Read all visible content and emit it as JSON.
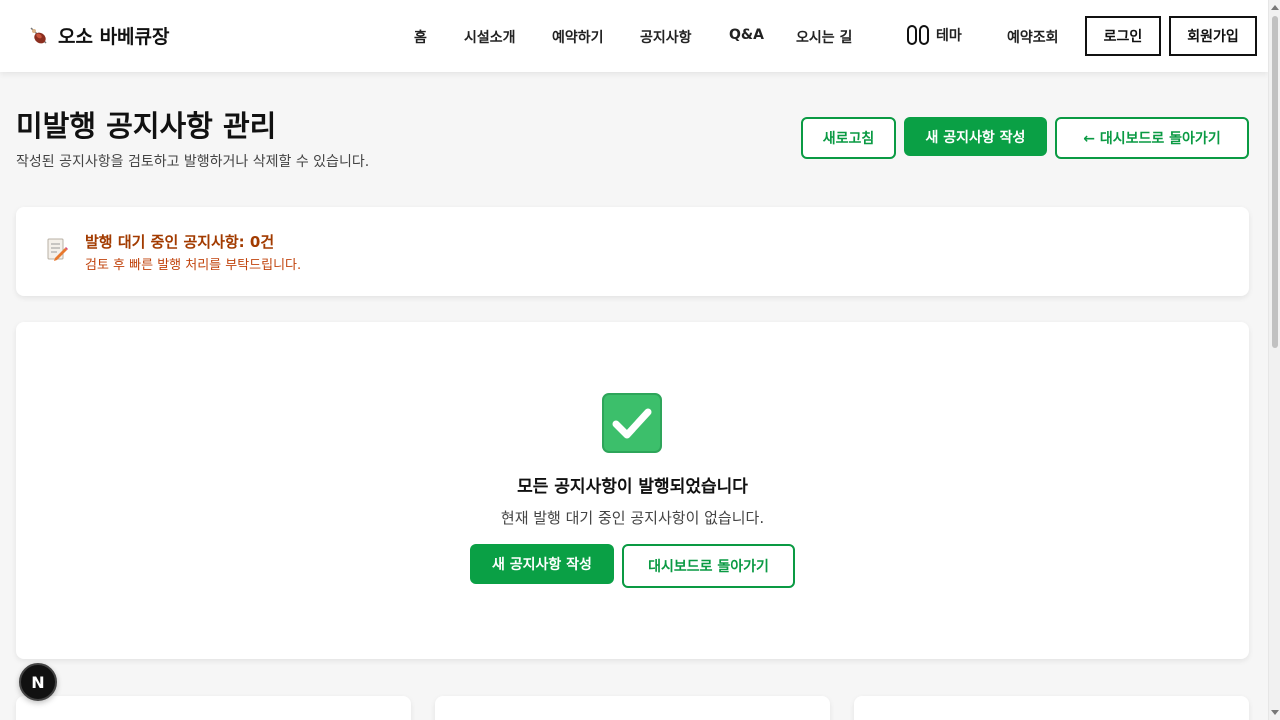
{
  "header": {
    "brand": "오소 바베큐장",
    "nav": [
      "홈",
      "시설소개",
      "예약하기",
      "공지사항",
      "Q&A",
      "오시는 길"
    ],
    "theme_label": "테마",
    "reservation_lookup": "예약조회",
    "login": "로그인",
    "signup": "회원가입"
  },
  "page": {
    "title": "미발행 공지사항 관리",
    "subtitle": "작성된 공지사항을 검토하고 발행하거나 삭제할 수 있습니다.",
    "refresh": "새로고침",
    "new_notice": "새 공지사항 작성",
    "back_dashboard": "← 대시보드로 돌아가기"
  },
  "status": {
    "title": "발행 대기 중인 공지사항: 0건",
    "subtitle": "검토 후 빠른 발행 처리를 부탁드립니다."
  },
  "empty": {
    "title": "모든 공지사항이 발행되었습니다",
    "subtitle": "현재 발행 대기 중인 공지사항이 없습니다.",
    "new_notice": "새 공지사항 작성",
    "back_dashboard": "대시보드로 돌아가기"
  },
  "next_badge": "N",
  "colors": {
    "accent": "#0aa045",
    "warning_title": "#a23b00",
    "warning_text": "#c1440e"
  }
}
